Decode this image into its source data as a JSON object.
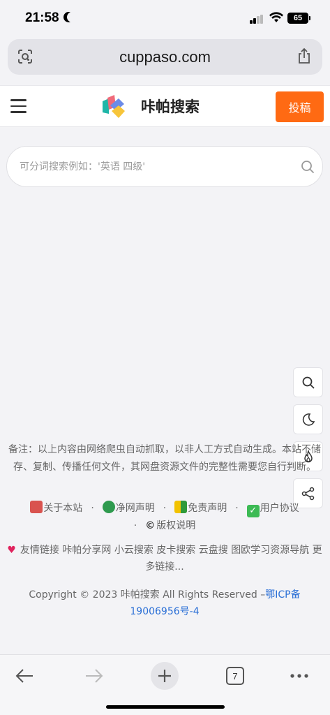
{
  "status_bar": {
    "time": "21:58",
    "battery": "65"
  },
  "browser": {
    "url": "cuppaso.com",
    "tabs_count": "7"
  },
  "header": {
    "site_title": "咔帕搜索",
    "post_label": "投稿"
  },
  "search": {
    "placeholder": "可分词搜索例如：'英语 四级'"
  },
  "footer": {
    "note": "备注：以上内容由网络爬虫自动抓取，以非人工方式自动生成。本站不储存、复制、传播任何文件，其网盘资源文件的完整性需要您自行判断。",
    "links": [
      "关于本站",
      "净网声明",
      "免责声明",
      "用户协议",
      "版权说明"
    ],
    "friend_links": [
      "友情链接",
      "咔帕分享网",
      "小云搜索",
      "皮卡搜索",
      "云盘搜",
      "图欧学习资源导航",
      "更多链接..."
    ],
    "copyright": "Copyright © 2023 咔帕搜索 All Rights Reserved –",
    "icp": "鄂ICP备19006956号-4"
  },
  "icons": {
    "float_buttons": [
      "search-icon",
      "moon-icon",
      "flame-icon",
      "share-icon"
    ],
    "toolbar": [
      "back-icon",
      "forward-icon",
      "plus-icon",
      "tabs-icon",
      "more-icon"
    ]
  },
  "colors": {
    "accent": "#ff6a13",
    "link": "#2a6fd6",
    "heart": "#e0245e"
  }
}
